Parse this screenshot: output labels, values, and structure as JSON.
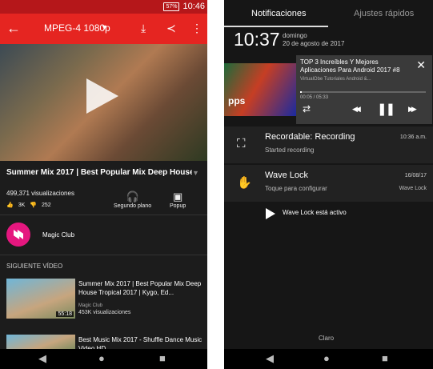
{
  "left": {
    "status": {
      "battery": "57%",
      "time": "10:46"
    },
    "appbar": {
      "back_icon": "←",
      "title": "MPEG-4 1080p",
      "caret": "▼",
      "download_icon": "⤓",
      "share_icon": "≺",
      "menu_icon": "⋮"
    },
    "video": {
      "title": "Summer Mix 2017 | Best Popular Mix Deep House...",
      "expand_icon": "▼",
      "views": "499,371 visualizaciones",
      "likes": "3K",
      "dislikes": "252",
      "like_icon": "👍",
      "dislike_icon": "👎",
      "background_label": "Segundo plano",
      "background_icon": "🎧",
      "popup_label": "Popup",
      "popup_icon": "▣",
      "channel_name": "Magic Club"
    },
    "next_label": "SIGUIENTE VÍDEO",
    "related": [
      {
        "title": "Summer Mix 2017 | Best Popular Mix Deep House Tropical 2017 | Kygo, Ed...",
        "channel": "Magic Club",
        "views": "453K visualizaciones",
        "duration": "55:18"
      },
      {
        "title": "Best Music Mix 2017 - Shuffle Dance Music Video HD",
        "channel": "",
        "views": "",
        "duration": ""
      }
    ]
  },
  "right": {
    "tabs": [
      "Notificaciones",
      "Ajustes rápidos"
    ],
    "clock": "10:37",
    "date_day": "domingo",
    "date": "20 de agosto de 2017",
    "media": {
      "art_text": "pps",
      "title": "TOP 3 Increíbles Y Mejores Aplicaciones Para Android 2017 #8",
      "subtitle": "VirtualObe Tutoriales Android &...",
      "time": "00:05 / 05:33",
      "progress": 0.015,
      "close_icon": "✕",
      "repeat_icon": "⇄",
      "prev_icon": "◀◀",
      "pause_icon": "❚❚",
      "next_icon": "▶▶"
    },
    "notifications": [
      {
        "icon": "⛶",
        "title": "Recordable: Recording",
        "subtitle": "Started recording",
        "time": "10:36 a.m.",
        "app": ""
      },
      {
        "icon": "✋",
        "title": "Wave Lock",
        "subtitle": "Toque para configurar",
        "time": "16/08/17",
        "app": "Wave Lock"
      }
    ],
    "wave_lock_active": "Wave Lock está activo",
    "carrier": "Claro"
  },
  "nav": {
    "back": "◀",
    "home": "●",
    "recents": "■"
  }
}
